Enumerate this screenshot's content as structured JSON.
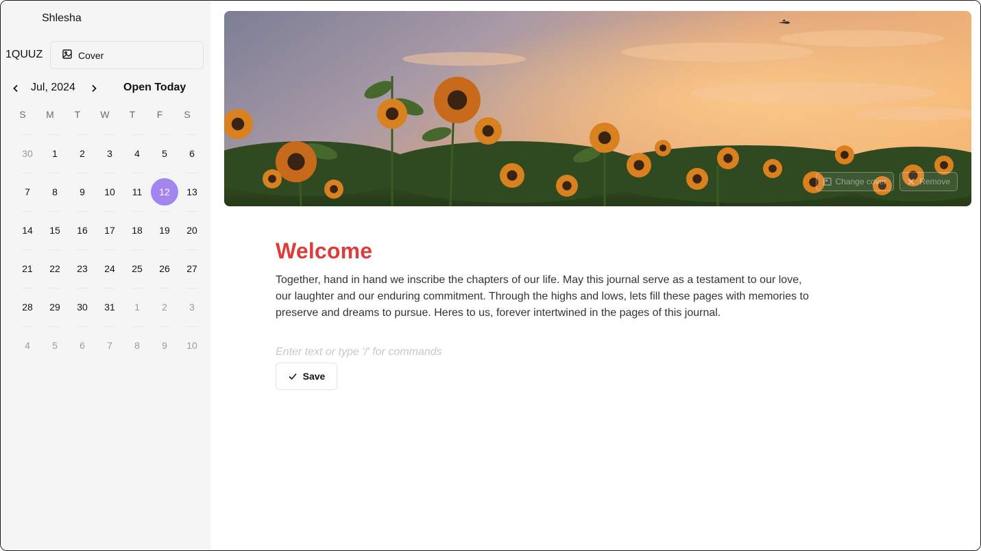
{
  "sidebar": {
    "username": "Shlesha",
    "code": "1QUUZ",
    "cover_label": "Cover"
  },
  "calendar": {
    "month_label": "Jul, 2024",
    "open_today_label": "Open Today",
    "weekdays": [
      "S",
      "M",
      "T",
      "W",
      "T",
      "F",
      "S"
    ],
    "weeks": [
      [
        {
          "d": "30",
          "m": true
        },
        {
          "d": "1"
        },
        {
          "d": "2"
        },
        {
          "d": "3"
        },
        {
          "d": "4"
        },
        {
          "d": "5"
        },
        {
          "d": "6"
        }
      ],
      [
        {
          "d": "7"
        },
        {
          "d": "8"
        },
        {
          "d": "9"
        },
        {
          "d": "10"
        },
        {
          "d": "11"
        },
        {
          "d": "12",
          "s": true
        },
        {
          "d": "13"
        }
      ],
      [
        {
          "d": "14"
        },
        {
          "d": "15"
        },
        {
          "d": "16"
        },
        {
          "d": "17"
        },
        {
          "d": "18"
        },
        {
          "d": "19"
        },
        {
          "d": "20"
        }
      ],
      [
        {
          "d": "21"
        },
        {
          "d": "22"
        },
        {
          "d": "23"
        },
        {
          "d": "24"
        },
        {
          "d": "25"
        },
        {
          "d": "26"
        },
        {
          "d": "27"
        }
      ],
      [
        {
          "d": "28"
        },
        {
          "d": "29"
        },
        {
          "d": "30"
        },
        {
          "d": "31"
        },
        {
          "d": "1",
          "m": true
        },
        {
          "d": "2",
          "m": true
        },
        {
          "d": "3",
          "m": true
        }
      ],
      [
        {
          "d": "4",
          "m": true
        },
        {
          "d": "5",
          "m": true
        },
        {
          "d": "6",
          "m": true
        },
        {
          "d": "7",
          "m": true
        },
        {
          "d": "8",
          "m": true
        },
        {
          "d": "9",
          "m": true
        },
        {
          "d": "10",
          "m": true
        }
      ]
    ],
    "selected_color": "#a385ef"
  },
  "cover": {
    "change_label": "Change cover",
    "remove_label": "Remove"
  },
  "entry": {
    "title": "Welcome",
    "body": "Together, hand in hand we inscribe the chapters of our life. May this journal serve as a testament to our love, our laughter and our enduring commitment. Through the highs and lows, lets fill these pages with memories to preserve and dreams to pursue. Heres to us, forever intertwined in the pages of this journal.",
    "placeholder": "Enter text or type '/' for commands",
    "save_label": "Save",
    "title_color": "#e03b3b"
  }
}
